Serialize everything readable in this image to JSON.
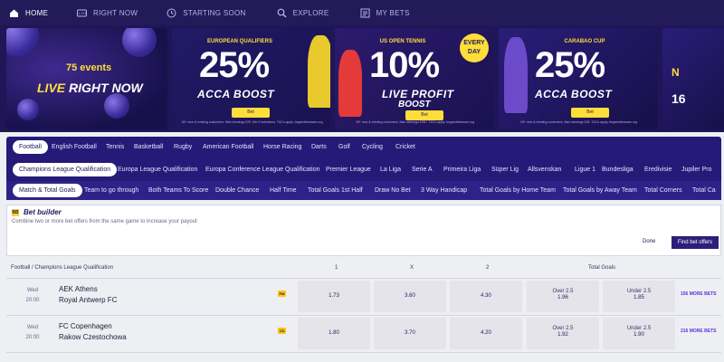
{
  "topnav": {
    "items": [
      {
        "label": "HOME",
        "icon": "home-icon"
      },
      {
        "label": "RIGHT NOW",
        "icon": "live-tv-icon"
      },
      {
        "label": "STARTING SOON",
        "icon": "clock-icon"
      },
      {
        "label": "EXPLORE",
        "icon": "search-icon"
      },
      {
        "label": "MY BETS",
        "icon": "betslip-icon"
      }
    ]
  },
  "banners": {
    "live": {
      "events": "75 events",
      "prefix": "LIVE",
      "suffix": "RIGHT NOW"
    },
    "qualifiers": {
      "tag": "EUROPEAN QUALIFIERS",
      "pct": "25%",
      "boost": "ACCA BOOST",
      "cta": "Bet",
      "terms": "18+ new & existing customers. Max winnings £25. Min 3 selections. T&Cs apply. begambleaware.org"
    },
    "tennis": {
      "tag": "US OPEN TENNIS",
      "pct": "10%",
      "boost": "LIVE PROFIT",
      "boost2": "BOOST",
      "badge": "EVERY DAY",
      "cta": "Bet",
      "terms": "18+ new & existing customers. Max winnings £250. T&Cs apply. begambleaware.org"
    },
    "carabao": {
      "tag": "CARABAO CUP",
      "pct": "25%",
      "boost": "ACCA BOOST",
      "cta": "Bet",
      "terms": "18+ new & existing customers. Max winnings £25. T&Cs apply. begambleaware.org"
    },
    "peek": {
      "line1": "N",
      "line2": "16"
    }
  },
  "sports": [
    "Football",
    "English Football",
    "Tennis",
    "Basketball",
    "Rugby",
    "American Football",
    "Horse Racing",
    "Darts",
    "Golf",
    "Cycling",
    "Cricket"
  ],
  "competitions": [
    "Champions League Qualification",
    "Europa League Qualification",
    "Europa Conference League Qualification",
    "Premier League",
    "La Liga",
    "Serie A",
    "Primeira Liga",
    "Süper Lig",
    "Allsvenskan",
    "Ligue 1",
    "Bundesliga",
    "Eredivisie",
    "Jupiler Pro"
  ],
  "markets": [
    "Match & Total Goals",
    "Team to go through",
    "Both Teams To Score",
    "Double Chance",
    "Half Time",
    "Total Goals 1st Half",
    "Draw No Bet",
    "3 Way Handicap",
    "Total Goals by Home Team",
    "Total Goals by Away Team",
    "Total Corners",
    "Total Ca"
  ],
  "bet_builder": {
    "title": "Bet builder",
    "description": "Combine two or more bet offers from the same game to increase your payout",
    "done": "Done",
    "find": "Find bet offers",
    "icon": "bet-builder-icon"
  },
  "table": {
    "breadcrumb": "Football / Champions League Qualification",
    "col_1": "1",
    "col_x": "X",
    "col_2": "2",
    "col_total": "Total Goals",
    "rows": [
      {
        "day": "Wed",
        "time": "20:00",
        "home": "AEK Athens",
        "away": "Royal Antwerp FC",
        "tv": "PM",
        "odds_1": "1.73",
        "odds_x": "3.60",
        "odds_2": "4.30",
        "over_label": "Over 2.5",
        "over_odds": "1.96",
        "under_label": "Under 2.5",
        "under_odds": "1.85",
        "more": "156 MORE BETS"
      },
      {
        "day": "Wed",
        "time": "20:00",
        "home": "FC Copenhagen",
        "away": "Rakow Czestochowa",
        "tv": "CD",
        "odds_1": "1.80",
        "odds_x": "3.70",
        "odds_2": "4.20",
        "over_label": "Over 2.5",
        "over_odds": "1.92",
        "under_label": "Under 2.5",
        "under_odds": "1.90",
        "more": "216 MORE BETS"
      }
    ]
  },
  "colors": {
    "nav_bg": "#231a5a",
    "strip_bg": "#261a78",
    "accent_yellow": "#ffde3b",
    "odds_bg": "#e4e4ea",
    "more_link": "#5b2fd6"
  }
}
